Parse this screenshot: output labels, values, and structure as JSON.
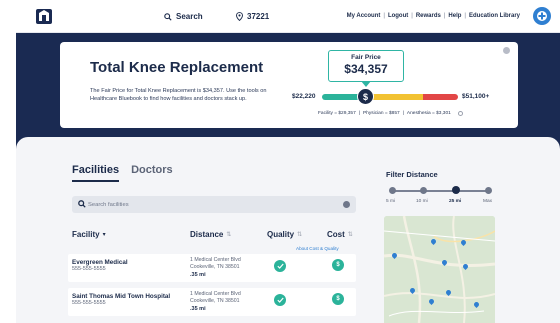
{
  "header": {
    "search_label": "Search",
    "zip": "37221",
    "nav": [
      "My Account",
      "Logout",
      "Rewards",
      "Help",
      "Education Library"
    ],
    "nav_separator": "|"
  },
  "procedure": {
    "title": "Total Knee Replacement",
    "description": "The Fair Price for Total Knee Replacement is $34,357. Use the tools on Healthcare Bluebook to find how facilities and doctors stack up.",
    "fair_price_label": "Fair Price",
    "fair_price_value": "$34,357",
    "range_low": "$22,220",
    "range_high": "$51,100+",
    "marker_symbol": "$",
    "breakdown": {
      "facility": "Facility = $29,357",
      "physician": "Physician = $857",
      "anesthesia": "Anesthesia = $3,301",
      "separator": "|"
    }
  },
  "tabs": {
    "facilities": "Facilities",
    "doctors": "Doctors"
  },
  "search": {
    "placeholder": "Search facilities"
  },
  "table": {
    "col_facility": "Facility",
    "col_distance": "Distance",
    "col_quality": "Quality",
    "col_cost": "Cost",
    "about_link": "About Cost & Quality",
    "rows": [
      {
        "name": "Evergreen Medical",
        "phone": "555-555-5555",
        "address_line1": "1 Medical Center Blvd",
        "address_line2": "Cookeville, TN 38501",
        "distance": ".35 mi",
        "cost_symbol": "$"
      },
      {
        "name": "Saint Thomas Mid Town Hospital",
        "phone": "555-555-5555",
        "address_line1": "1 Medical Center Blvd",
        "address_line2": "Cookeville, TN 38501",
        "distance": ".35 mi",
        "cost_symbol": "$"
      }
    ]
  },
  "filter": {
    "title": "Filter Distance",
    "stops": [
      "5 mi",
      "10 mi",
      "25 mi",
      "Max"
    ],
    "selected": "25 mi"
  },
  "colors": {
    "navy": "#1a2a52",
    "teal": "#2bb39a",
    "yellow": "#f2c232",
    "red": "#e24646",
    "link_blue": "#2f7fd1"
  }
}
